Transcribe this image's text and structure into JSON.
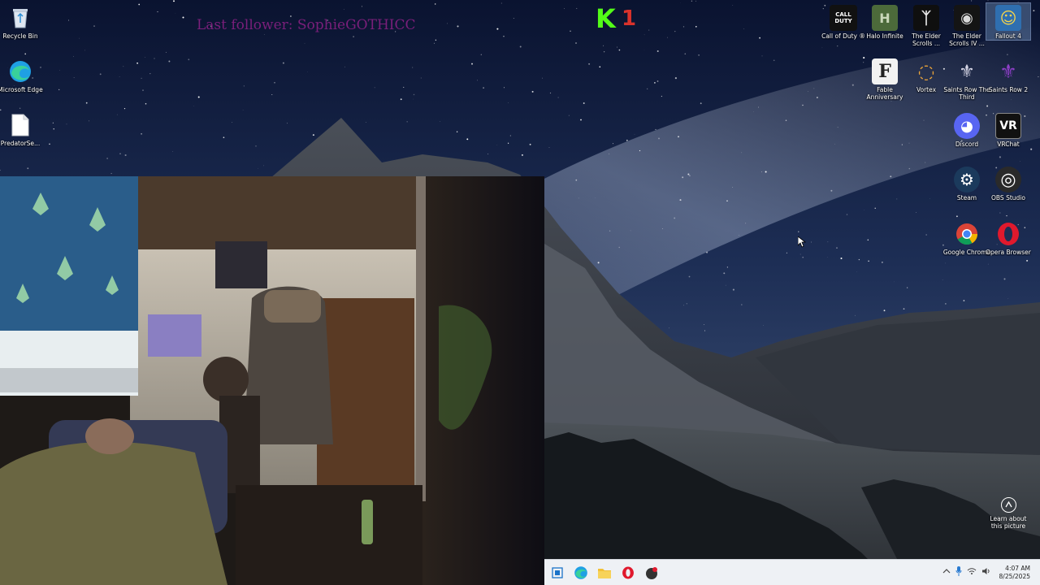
{
  "overlay": {
    "last_follower": "Last follower: SophieGOTHICC",
    "kick_count": "1",
    "kick_logo": "K"
  },
  "desktop_left": [
    {
      "name": "recycle-bin",
      "label": "Recycle Bin",
      "icon": "recycle-bin-icon"
    },
    {
      "name": "microsoft-edge",
      "label": "Microsoft Edge",
      "icon": "edge-icon"
    },
    {
      "name": "predatorse",
      "label": "PredatorSe...",
      "icon": "file-icon"
    }
  ],
  "desktop_right": [
    {
      "name": "call-of-duty",
      "label": "Call of Duty ®",
      "icon": "call-of-duty-icon",
      "glyph": "CALL DUTY"
    },
    {
      "name": "halo-infinite",
      "label": "Halo Infinite",
      "icon": "halo-infinite-icon",
      "glyph": "H"
    },
    {
      "name": "elder-scrolls-skyrim",
      "label": "The Elder Scrolls ...",
      "icon": "skyrim-icon",
      "glyph": "ᛉ"
    },
    {
      "name": "elder-scrolls-oblivion",
      "label": "The Elder Scrolls IV ...",
      "icon": "oblivion-icon",
      "glyph": "◉"
    },
    {
      "name": "fallout-4",
      "label": "Fallout 4",
      "icon": "fallout-4-icon",
      "glyph": "☺"
    },
    {
      "name": "fable-anniversary",
      "label": "Fable Anniversary",
      "icon": "fable-icon",
      "glyph": "F"
    },
    {
      "name": "vortex",
      "label": "Vortex",
      "icon": "vortex-icon",
      "glyph": "◌"
    },
    {
      "name": "saints-row-third",
      "label": "Saints Row The Third",
      "icon": "saints-row-3-icon",
      "glyph": "⚜"
    },
    {
      "name": "saints-row-2",
      "label": "Saints Row 2",
      "icon": "saints-row-2-icon",
      "glyph": "⚜"
    },
    {
      "name": "discord",
      "label": "Discord",
      "icon": "discord-icon",
      "glyph": "◕"
    },
    {
      "name": "vrchat",
      "label": "VRChat",
      "icon": "vrchat-icon",
      "glyph": "VR"
    },
    {
      "name": "steam",
      "label": "Steam",
      "icon": "steam-icon",
      "glyph": "⚙"
    },
    {
      "name": "obs-studio",
      "label": "OBS Studio",
      "icon": "obs-icon",
      "glyph": "◎"
    },
    {
      "name": "google-chrome",
      "label": "Google Chrome",
      "icon": "chrome-icon",
      "glyph": "◉"
    },
    {
      "name": "opera-browser",
      "label": "Opera Browser",
      "icon": "opera-icon",
      "glyph": "O"
    }
  ],
  "learn": {
    "label": "Learn about this picture",
    "icon": "camera-icon"
  },
  "taskbar": {
    "apps": [
      {
        "name": "start-button",
        "icon": "windows-icon",
        "glyph": "▣"
      },
      {
        "name": "taskbar-edge",
        "icon": "edge-icon",
        "glyph": "◕"
      },
      {
        "name": "taskbar-file-explorer",
        "icon": "folder-icon",
        "glyph": "▬"
      },
      {
        "name": "taskbar-opera",
        "icon": "opera-icon",
        "glyph": "O"
      },
      {
        "name": "taskbar-app",
        "icon": "app-icon",
        "glyph": "●"
      }
    ],
    "tray_icons": [
      {
        "name": "show-hidden-icons",
        "icon": "chevron-up-icon",
        "glyph": "⌃"
      },
      {
        "name": "microphone",
        "icon": "microphone-icon",
        "glyph": "🎙"
      },
      {
        "name": "wifi",
        "icon": "wifi-icon",
        "glyph": "◠"
      },
      {
        "name": "volume",
        "icon": "volume-icon",
        "glyph": "🔈"
      }
    ],
    "time": "4:07 AM",
    "date": "8/25/2025"
  },
  "colors": {
    "kick_green": "#53fc18",
    "follower_purple": "#7a1f7a",
    "taskbar_bg": "#eef1f5"
  }
}
